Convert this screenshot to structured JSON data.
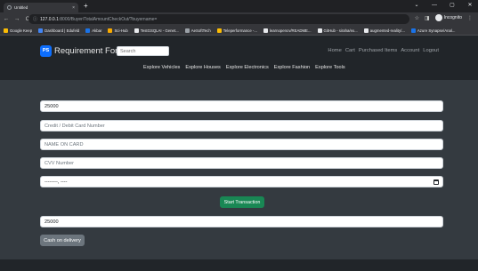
{
  "browser": {
    "tab_title": "Untitled",
    "tab_close": "×",
    "new_tab": "+",
    "window_controls": [
      "⌄",
      "—",
      "▢",
      "✕"
    ],
    "nav": {
      "back": "←",
      "forward": "→",
      "reload": "C"
    },
    "url_host": "127.0.0.1",
    "url_path": ":8000/Buyer/TotalAmountCheckOut/?buyername=",
    "toolbar_icons": {
      "star": "☆",
      "panel": "◨"
    },
    "incognito_label": "Incognito",
    "menu": "⋮",
    "bookmarks": [
      {
        "label": "Google Keep",
        "color": "#fbbc04"
      },
      {
        "label": "Dashboard | Edufeld",
        "color": "#4285f4"
      },
      {
        "label": "Akbar",
        "color": "#1a73e8"
      },
      {
        "label": "Sci-Hub",
        "color": "#f9ab00"
      },
      {
        "label": "TestGSQLAI - Genet...",
        "color": "#e8eaed"
      },
      {
        "label": "AeSoftTech",
        "color": "#9aa0a6"
      },
      {
        "label": "Teleperformance -...",
        "color": "#fbbc04"
      },
      {
        "label": "learnopencv/README...",
        "color": "#e8eaed"
      },
      {
        "label": "GitHub - siraha/ex...",
        "color": "#e8eaed"
      },
      {
        "label": "augmented-reality/...",
        "color": "#e8eaed"
      },
      {
        "label": "Azure Synapse/Anal...",
        "color": "#1a73e8"
      }
    ]
  },
  "site": {
    "logo_text": "PS",
    "brand": "Requirement For Rent",
    "search_placeholder": "Search",
    "right_links": [
      "Home",
      "Cart",
      "Purchased Items",
      "Account",
      "Logout"
    ],
    "sub_links": [
      "Explore Vehicles",
      "Explore Houses",
      "Explore Electronics",
      "Explore Fashion",
      "Explore Tools"
    ]
  },
  "form": {
    "amount_value": "25000",
    "card_placeholder": "Credit / Debit Card Number",
    "name_placeholder": "NAME ON CARD",
    "cvv_placeholder": "CVV Number",
    "date_mask": "--------, ----",
    "start_button": "Start Transaction",
    "amount2_value": "25000",
    "cod_button": "Cash on delivery"
  },
  "colors": {
    "page_bg": "#343a40",
    "navbar_bg": "#212529",
    "brand_blue": "#0d6efd",
    "success_green": "#198754",
    "secondary_grey": "#6c757d"
  }
}
